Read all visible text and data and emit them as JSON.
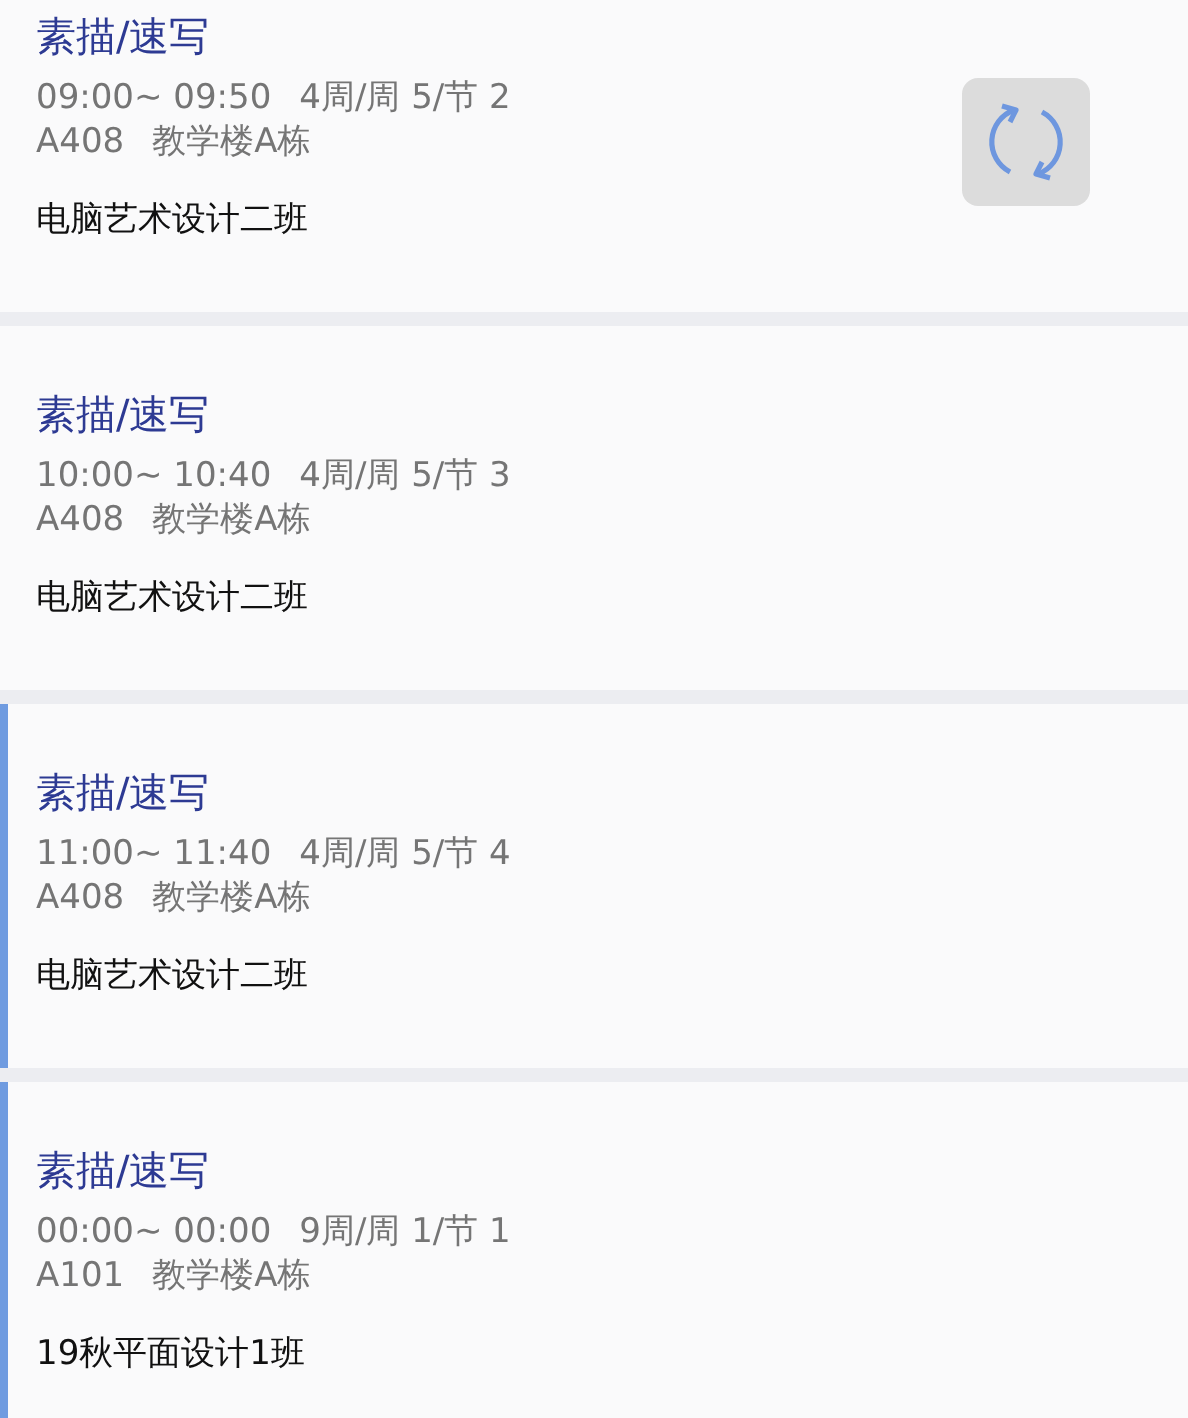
{
  "cards": [
    {
      "course": "素描/速写",
      "time": "09:00~ 09:50",
      "schedule": "4周/周 5/节 2",
      "room": "A408",
      "building": "教学楼A栋",
      "class_name": "电脑艺术设计二班",
      "selected": false,
      "refresh_button": true
    },
    {
      "course": "素描/速写",
      "time": "10:00~ 10:40",
      "schedule": "4周/周 5/节 3",
      "room": "A408",
      "building": "教学楼A栋",
      "class_name": "电脑艺术设计二班",
      "selected": false,
      "refresh_button": false
    },
    {
      "course": "素描/速写",
      "time": "11:00~ 11:40",
      "schedule": "4周/周 5/节 4",
      "room": "A408",
      "building": "教学楼A栋",
      "class_name": "电脑艺术设计二班",
      "selected": true,
      "refresh_button": false
    },
    {
      "course": "素描/速写",
      "time": "00:00~ 00:00",
      "schedule": "9周/周 1/节 1",
      "room": "A101",
      "building": "教学楼A栋",
      "class_name": "19秋平面设计1班",
      "selected": true,
      "refresh_button": false
    }
  ]
}
